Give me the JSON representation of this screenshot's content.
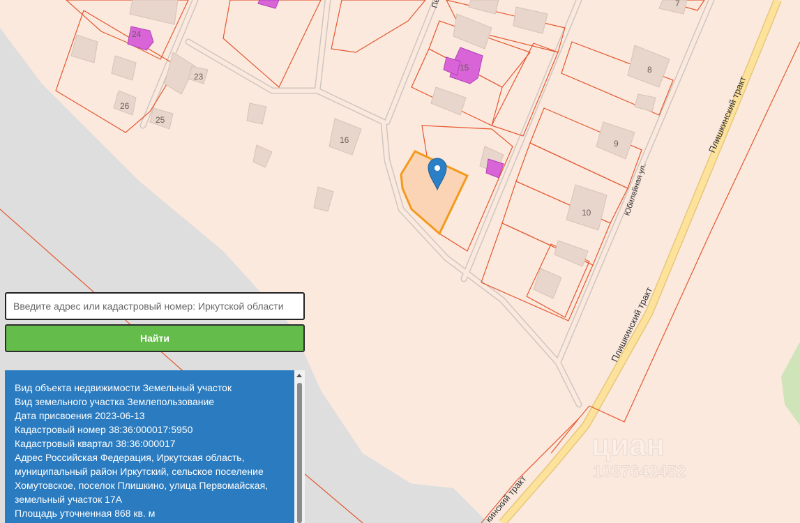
{
  "map": {
    "house_numbers": [
      "24",
      "23",
      "26",
      "25",
      "16",
      "15",
      "8",
      "9",
      "10",
      "7"
    ],
    "street_labels": {
      "jubilee": "Юбилейная ул.",
      "plishkino_upper": "Плишкинский тракт",
      "plishkino_mid": "Плишкинский тракт",
      "plishkino_lower": "кинский тракт",
      "top_cut": "Пе"
    },
    "watermark": {
      "brand": "циан",
      "code": "1037642452"
    },
    "colors": {
      "background": "#fbe9de",
      "parcel_border": "#e4572e",
      "selected_fill": "#fad4b4",
      "selected_border": "#f39a1c",
      "building": "#e8d6cc",
      "building_highlight": "#d864d8",
      "road": "#fde29c",
      "marker": "#2b7fc7"
    },
    "marker_icon": "map-pin-icon"
  },
  "search": {
    "placeholder": "Введите адрес или кадастровый номер: Иркутской области",
    "button_label": "Найти"
  },
  "info": {
    "rows": [
      {
        "label": "Вид объекта недвижимости",
        "value": "Земельный участок"
      },
      {
        "label": "Вид земельного участка",
        "value": "Землепользование"
      },
      {
        "label": "Дата присвоения",
        "value": "2023-06-13"
      },
      {
        "label": "Кадастровый номер",
        "value": "38:36:000017:5950"
      },
      {
        "label": "Кадастровый квартал",
        "value": "38:36:000017"
      },
      {
        "label": "Адрес",
        "value": "Российская Федерация, Иркутская область, муниципальный район Иркутский, сельское поселение Хомутовское, поселок Плишкино, улица Первомайская, земельный участок 17А"
      },
      {
        "label": "Площадь уточненная",
        "value": "868 кв. м"
      }
    ]
  }
}
